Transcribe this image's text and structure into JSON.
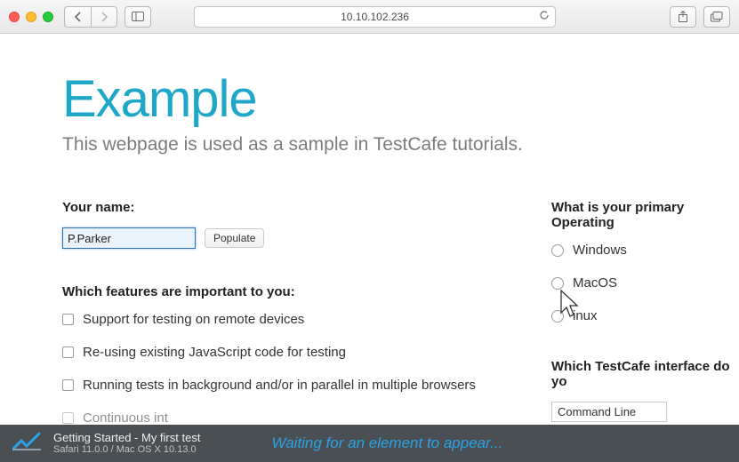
{
  "browser": {
    "address": "10.10.102.236"
  },
  "page": {
    "heading": "Example",
    "subtitle": "This webpage is used as a sample in TestCafe tutorials."
  },
  "form": {
    "name_label": "Your name:",
    "name_value": "P.Parker",
    "populate_label": "Populate",
    "features_label": "Which features are important to you:",
    "features": [
      "Support for testing on remote devices",
      "Re-using existing JavaScript code for testing",
      "Running tests in background and/or in parallel in multiple browsers",
      "Continuous int"
    ],
    "os_label": "What is your primary Operating",
    "os_options": [
      "Windows",
      "MacOS",
      "inux"
    ],
    "interface_label": "Which TestCafe interface do yo",
    "interface_value": "Command Line"
  },
  "status": {
    "title": "Getting Started - My first test",
    "env": "Safari 11.0.0 / Mac OS X 10.13.0",
    "message": "Waiting for an element to appear..."
  }
}
